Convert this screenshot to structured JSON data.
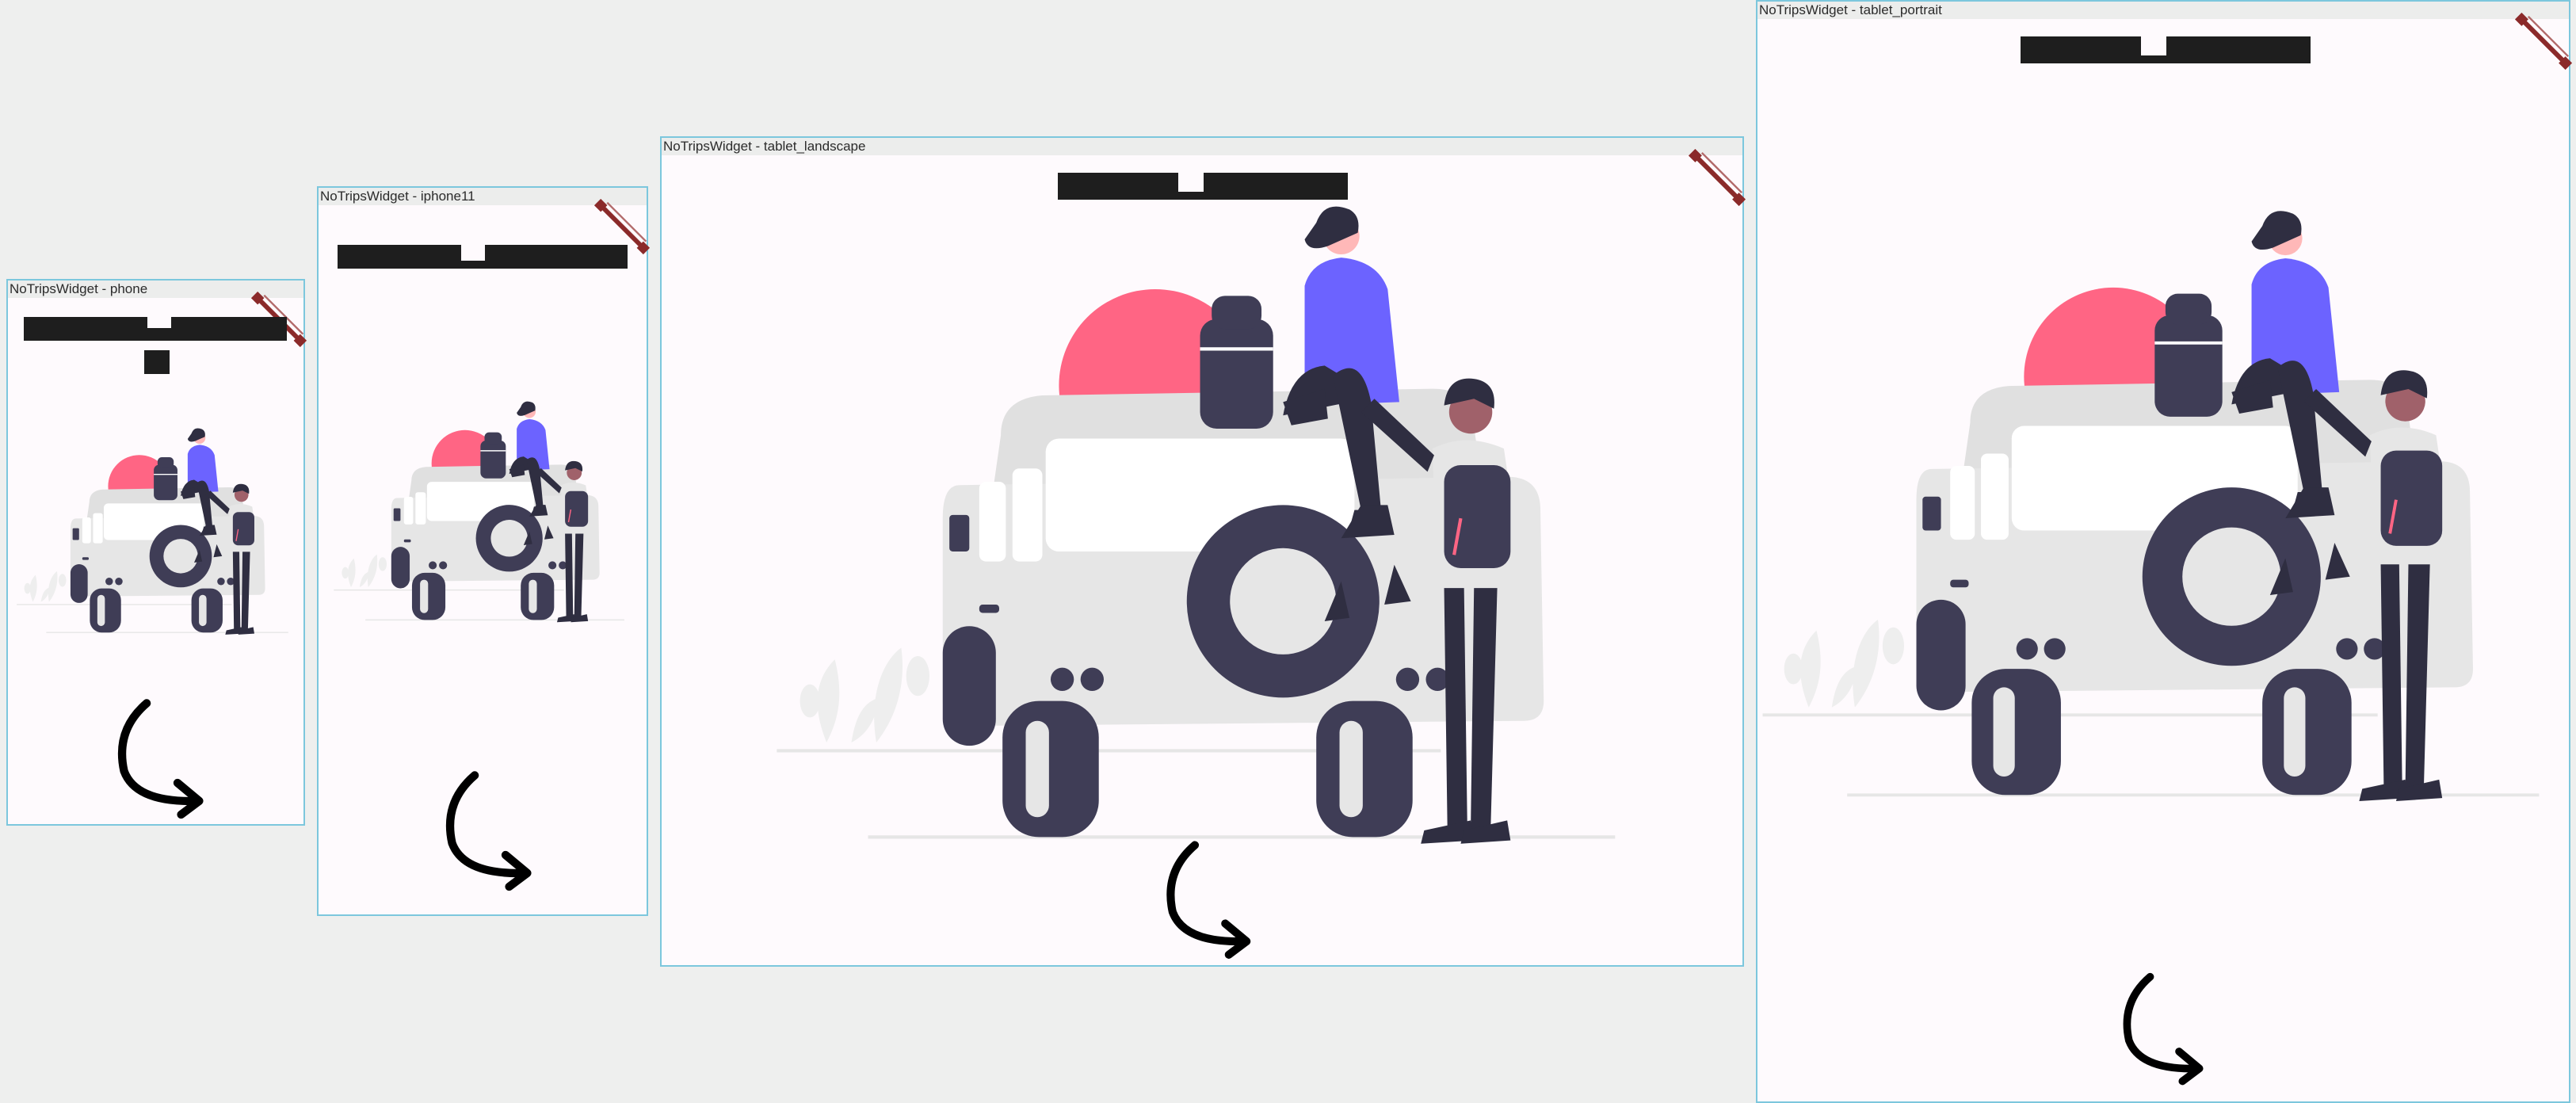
{
  "frames": [
    {
      "label": "NoTripsWidget - phone",
      "title_lines": 2
    },
    {
      "label": "NoTripsWidget - iphone11",
      "title_lines": 1
    },
    {
      "label": "NoTripsWidget - tablet_landscape",
      "title_lines": 1
    },
    {
      "label": "NoTripsWidget - tablet_portrait",
      "title_lines": 1
    }
  ],
  "icons": {
    "illustration": "travel-car-illustration",
    "arrow": "curved-arrow-icon",
    "banner": "debug-banner-icon"
  },
  "colors": {
    "canvas": "#eeefee",
    "frame_bg": "#fefafd",
    "frame_border": "#7cc7dd",
    "title_bar": "#1e1e1e",
    "sun": "#ff6584",
    "shirt": "#6c63ff",
    "dark": "#3f3d56",
    "car": "#e6e6e6",
    "banner": "#8b2a2a"
  }
}
